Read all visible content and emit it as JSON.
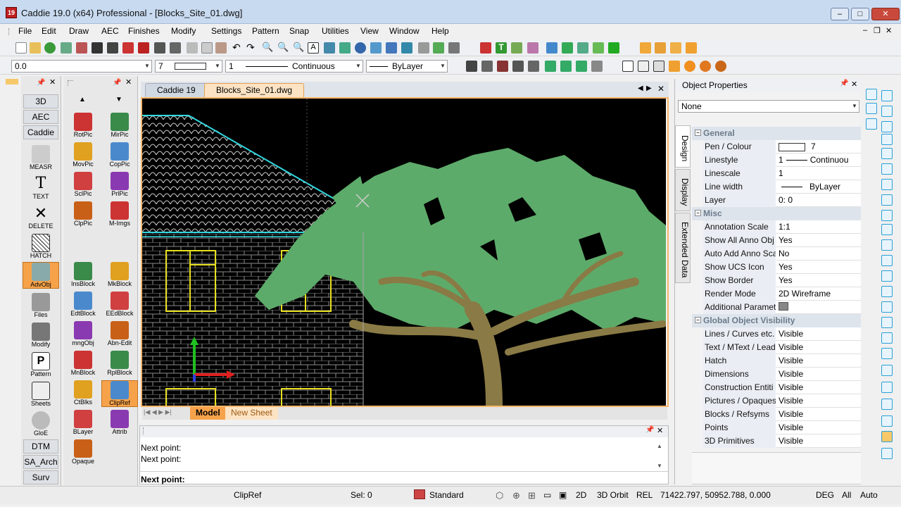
{
  "window": {
    "title": "Caddie 19.0 (x64) Professional - [Blocks_Site_01.dwg]",
    "app_icon": "19",
    "minimize": "‒",
    "maximize": "□",
    "close": "✕"
  },
  "menu": [
    "File",
    "Edit",
    "Draw",
    "AEC",
    "Finishes",
    "Modify",
    "Settings",
    "Pattern",
    "Snap",
    "Utilities",
    "View",
    "Window",
    "Help"
  ],
  "props_toolbar": {
    "coord_value": "0.0",
    "pen": "7",
    "linestyle_num": "1",
    "linestyle": "Continuous",
    "line_width": "ByLayer"
  },
  "left_panel": {
    "category_buttons_top": [
      "3D",
      "AEC",
      "Caddie"
    ],
    "tools": [
      {
        "label": "MEASR",
        "icon": "measure-icon"
      },
      {
        "label": "TEXT",
        "icon": "text-icon"
      },
      {
        "label": "DELETE",
        "icon": "delete-icon"
      },
      {
        "label": "HATCH",
        "icon": "hatch-icon"
      },
      {
        "label": "AdvObj",
        "icon": "advanced-object-icon"
      },
      {
        "label": "Files",
        "icon": "files-icon"
      },
      {
        "label": "Modify",
        "icon": "modify-icon"
      },
      {
        "label": "Pattern",
        "icon": "pattern-icon"
      },
      {
        "label": "Sheets",
        "icon": "sheets-icon"
      },
      {
        "label": "GloE",
        "icon": "global-edit-icon"
      }
    ],
    "category_buttons_bottom": [
      "DTM",
      "SA_Arch",
      "Surv"
    ]
  },
  "block_panel": {
    "tools": [
      [
        "RotPic",
        "MirPic"
      ],
      [
        "MovPic",
        "CopPic"
      ],
      [
        "SclPic",
        "PrlPic"
      ],
      [
        "ClpPic",
        "M-Imgs"
      ],
      [
        "InsBlock",
        "MkBlock"
      ],
      [
        "EdtBlock",
        "EEdBlock"
      ],
      [
        "mngObj",
        "Abn-Edit"
      ],
      [
        "MnBlock",
        "RplBlock"
      ],
      [
        "CtBlks",
        "ClipRef"
      ],
      [
        "BLayer",
        "Attrib"
      ],
      [
        "Opaque",
        ""
      ]
    ]
  },
  "doc_tabs": {
    "tabs": [
      "Caddie 19",
      "Blocks_Site_01.dwg"
    ],
    "active": "Blocks_Site_01.dwg"
  },
  "sheet_tabs": [
    "Model",
    "New Sheet"
  ],
  "command": {
    "history": [
      "Next point:",
      "Next point:"
    ],
    "prompt": "Next point:"
  },
  "object_properties": {
    "title": "Object Properties",
    "selection": "None",
    "side_tabs": [
      "Design",
      "Display",
      "Extended Data"
    ],
    "sections": [
      {
        "name": "General",
        "rows": [
          {
            "k": "Pen / Colour",
            "v": "7"
          },
          {
            "k": "Linestyle",
            "v": "1",
            "extra": "Continuou"
          },
          {
            "k": "Linescale",
            "v": "1"
          },
          {
            "k": "Line width",
            "v": "ByLayer"
          },
          {
            "k": "Layer",
            "v": "0: 0"
          }
        ]
      },
      {
        "name": "Misc",
        "rows": [
          {
            "k": "Annotation Scale",
            "v": "1:1"
          },
          {
            "k": "Show All Anno Obj",
            "v": "Yes"
          },
          {
            "k": "Auto Add Anno Sca",
            "v": "No"
          },
          {
            "k": "Show UCS Icon",
            "v": "Yes"
          },
          {
            "k": "Show Border",
            "v": "Yes"
          },
          {
            "k": "Render Mode",
            "v": "2D Wireframe"
          },
          {
            "k": "Additional Paramet",
            "v": ""
          }
        ]
      },
      {
        "name": "Global Object Visibility",
        "rows": [
          {
            "k": "Lines / Curves etc.",
            "v": "Visible"
          },
          {
            "k": "Text / MText / Lead",
            "v": "Visible"
          },
          {
            "k": "Hatch",
            "v": "Visible"
          },
          {
            "k": "Dimensions",
            "v": "Visible"
          },
          {
            "k": "Construction Entiti",
            "v": "Visible"
          },
          {
            "k": "Pictures / Opaques",
            "v": "Visible"
          },
          {
            "k": "Blocks / Refsyms",
            "v": "Visible"
          },
          {
            "k": "Points",
            "v": "Visible"
          },
          {
            "k": "3D Primitives",
            "v": "Visible"
          }
        ]
      }
    ]
  },
  "status": {
    "command": "ClipRef",
    "selection": "Sel: 0",
    "style": "Standard",
    "mode2d": "2D",
    "orbit": "3D Orbit",
    "rel": "REL",
    "coords": "71422.797, 50952.788, 0.000",
    "angle": "DEG",
    "all": "All",
    "auto": "Auto"
  },
  "colors": {
    "canvas_bg": "#000000",
    "tree_green": "#5dab6a",
    "trunk": "#8a7a45",
    "window_yellow": "#e8e020",
    "roof_line": "#30d8e0",
    "accent_orange": "#f6a24a"
  }
}
